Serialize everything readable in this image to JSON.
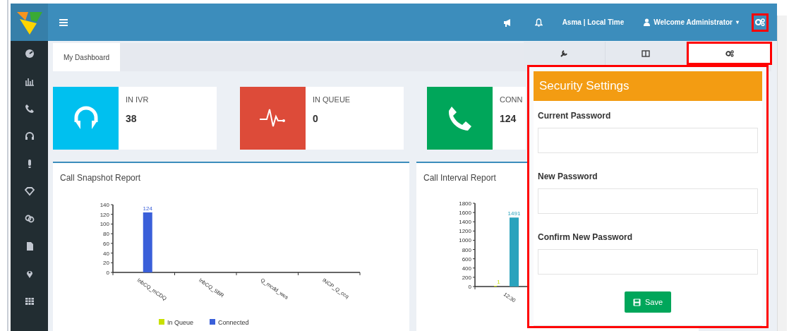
{
  "sidebar": {
    "items": [
      {
        "kind": "gauge"
      },
      {
        "kind": "chart"
      },
      {
        "kind": "phone"
      },
      {
        "kind": "headset"
      },
      {
        "kind": "bulb"
      },
      {
        "kind": "diamond"
      },
      {
        "kind": "users"
      },
      {
        "kind": "document"
      },
      {
        "kind": "pin"
      },
      {
        "kind": "table"
      }
    ]
  },
  "header": {
    "time_zone": "Asma | Local Time",
    "user": "Welcome Administrator",
    "user_caret": "▾",
    "settings_highlighted": true
  },
  "tabs": [
    {
      "label": "My Dashboard",
      "selected": true
    }
  ],
  "stats": [
    {
      "label": "IN IVR",
      "value": "38",
      "color": "#00c0ef",
      "kind": "headset"
    },
    {
      "label": "IN QUEUE",
      "value": "0",
      "color": "#dd4b39",
      "kind": "pulse"
    },
    {
      "label": "CONN",
      "value": "124",
      "color": "#00a65a",
      "kind": "phone"
    }
  ],
  "reports": [
    {
      "title": "Call Snapshot Report",
      "chart_data": {
        "type": "bar",
        "categories": [
          "InbCQ_mCDQ",
          "InbCQ_SBR",
          "Q_mcdd_wes",
          "INCP_Q_ccq"
        ],
        "series": [
          {
            "name": "In Queue",
            "color": "#c8e000",
            "values": [
              0,
              0,
              0,
              0
            ]
          },
          {
            "name": "Connected",
            "color": "#3a5fd9",
            "values": [
              124,
              0,
              0,
              0
            ]
          }
        ],
        "ylim": [
          0,
          140
        ],
        "yticks": [
          0,
          20,
          40,
          60,
          80,
          100,
          120,
          140
        ],
        "value_labels": [
          "124"
        ]
      }
    },
    {
      "title": "Call Interval Report",
      "chart_data": {
        "type": "bar",
        "categories": [
          "12:30"
        ],
        "series": [
          {
            "color": "#c8e000",
            "values": [
              1
            ]
          },
          {
            "color": "#2aa3bd",
            "values": [
              1491
            ]
          }
        ],
        "ylim": [
          0,
          1800
        ],
        "yticks": [
          0,
          200,
          400,
          600,
          800,
          1000,
          1200,
          1400,
          1600,
          1800
        ],
        "value_labels": [
          "1",
          "1491"
        ]
      }
    }
  ],
  "control_panel": {
    "highlighted": true,
    "tabs": [
      {
        "kind": "wrench",
        "selected": false
      },
      {
        "kind": "columns",
        "selected": false
      },
      {
        "kind": "gears",
        "selected": true,
        "highlighted": true
      }
    ],
    "title": "Security Settings",
    "fields": [
      {
        "label": "Current Password"
      },
      {
        "label": "New Password"
      },
      {
        "label": "Confirm New Password"
      }
    ],
    "button": "Save"
  }
}
